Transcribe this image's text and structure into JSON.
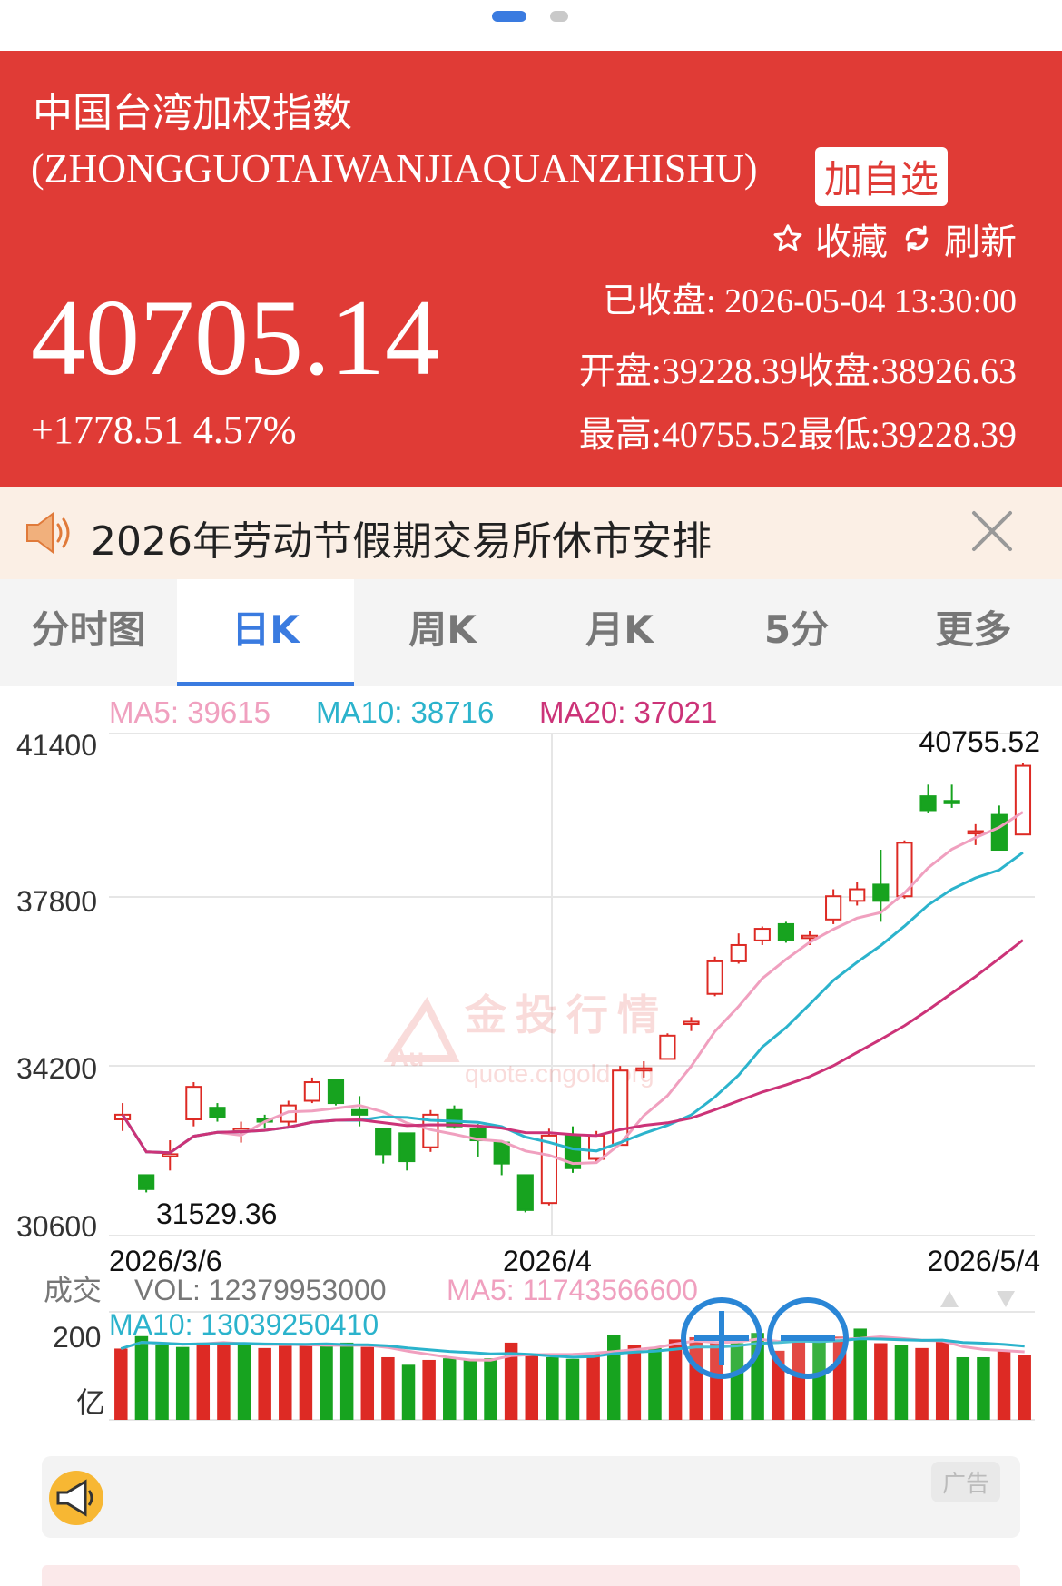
{
  "header": {
    "name": "中国台湾加权指数",
    "pinyin": "(ZHONGGUOTAIWANJIAQUANZHISHU)",
    "add_label": "加自选",
    "favorite_label": "收藏",
    "refresh_label": "刷新",
    "price": "40705.14",
    "change": "+1778.51 4.57%",
    "status": "已收盘: 2026-05-04 13:30:00",
    "open_close": "开盘:39228.39收盘:38926.63",
    "high_low": "最高:40755.52最低:39228.39"
  },
  "notice": {
    "text": "2026年劳动节假期交易所休市安排"
  },
  "tabs": [
    {
      "label": "分时图",
      "active": false
    },
    {
      "label": "日K",
      "active": true
    },
    {
      "label": "周K",
      "active": false
    },
    {
      "label": "月K",
      "active": false
    },
    {
      "label": "5分",
      "active": false
    },
    {
      "label": "更多",
      "active": false
    }
  ],
  "ma_legend": {
    "ma5": "MA5: 39615",
    "ma10": "MA10: 38716",
    "ma20": "MA20: 37021"
  },
  "watermark": {
    "cn": "金投行情",
    "url": "quote.cngold.org"
  },
  "colors": {
    "up": "#dd2a24",
    "down": "#17a31f",
    "ma5": "#f0a0bf",
    "ma10": "#2bb3cc",
    "ma20": "#cc3378",
    "header": "#e03b36",
    "accent": "#3a7be0"
  },
  "volume_legend": {
    "label": "成交",
    "vol": "VOL: 12379953000",
    "ma5": "MA5: 11743566600",
    "ma10": "MA10: 13039250410",
    "axis_top": "200",
    "axis_unit": "亿"
  },
  "ad": {
    "label": "广告"
  },
  "chart_data": {
    "type": "candlestick",
    "title": "",
    "ylim": [
      30600,
      41400
    ],
    "y_ticks": [
      "41400",
      "37800",
      "34200",
      "30600"
    ],
    "x_ticks": [
      "2026/3/6",
      "2026/4",
      "2026/5/4"
    ],
    "max_label": "40755.52",
    "min_label": "31529.36",
    "candles": [
      {
        "o": 33100,
        "c": 33200,
        "h": 33450,
        "l": 32850
      },
      {
        "o": 31900,
        "c": 31600,
        "h": 31900,
        "l": 31529.36
      },
      {
        "o": 32300,
        "c": 32350,
        "h": 32650,
        "l": 32000
      },
      {
        "o": 33100,
        "c": 33800,
        "h": 33900,
        "l": 32950
      },
      {
        "o": 33350,
        "c": 33150,
        "h": 33450,
        "l": 33050
      },
      {
        "o": 32850,
        "c": 32900,
        "h": 33050,
        "l": 32600
      },
      {
        "o": 33100,
        "c": 33050,
        "h": 33200,
        "l": 32900
      },
      {
        "o": 33050,
        "c": 33400,
        "h": 33500,
        "l": 32950
      },
      {
        "o": 33500,
        "c": 33900,
        "h": 34000,
        "l": 33450
      },
      {
        "o": 33950,
        "c": 33450,
        "h": 33950,
        "l": 33400
      },
      {
        "o": 33300,
        "c": 33200,
        "h": 33600,
        "l": 32950
      },
      {
        "o": 32900,
        "c": 32350,
        "h": 32900,
        "l": 32150
      },
      {
        "o": 32800,
        "c": 32200,
        "h": 32800,
        "l": 32000
      },
      {
        "o": 32500,
        "c": 33200,
        "h": 33300,
        "l": 32400
      },
      {
        "o": 33300,
        "c": 32950,
        "h": 33400,
        "l": 32900
      },
      {
        "o": 32900,
        "c": 32650,
        "h": 33000,
        "l": 32300
      },
      {
        "o": 32600,
        "c": 32150,
        "h": 32600,
        "l": 31900
      },
      {
        "o": 31900,
        "c": 31150,
        "h": 31900,
        "l": 31100
      },
      {
        "o": 31300,
        "c": 32750,
        "h": 32900,
        "l": 31250
      },
      {
        "o": 32750,
        "c": 32050,
        "h": 32950,
        "l": 31950
      },
      {
        "o": 32250,
        "c": 32750,
        "h": 32850,
        "l": 32150
      },
      {
        "o": 32550,
        "c": 34150,
        "h": 34250,
        "l": 32550
      },
      {
        "o": 34150,
        "c": 34200,
        "h": 34350,
        "l": 34000
      },
      {
        "o": 34400,
        "c": 34900,
        "h": 34950,
        "l": 34400
      },
      {
        "o": 35150,
        "c": 35200,
        "h": 35300,
        "l": 35000
      },
      {
        "o": 35800,
        "c": 36500,
        "h": 36600,
        "l": 35750
      },
      {
        "o": 36500,
        "c": 36850,
        "h": 37100,
        "l": 36450
      },
      {
        "o": 36950,
        "c": 37200,
        "h": 37250,
        "l": 36850
      },
      {
        "o": 37300,
        "c": 36950,
        "h": 37350,
        "l": 36900
      },
      {
        "o": 37000,
        "c": 37050,
        "h": 37150,
        "l": 36850
      },
      {
        "o": 37400,
        "c": 37900,
        "h": 38050,
        "l": 37300
      },
      {
        "o": 37800,
        "c": 38050,
        "h": 38200,
        "l": 37700
      },
      {
        "o": 38150,
        "c": 37800,
        "h": 38900,
        "l": 37350
      },
      {
        "o": 37900,
        "c": 39050,
        "h": 39100,
        "l": 37850
      },
      {
        "o": 40050,
        "c": 39750,
        "h": 40300,
        "l": 39700
      },
      {
        "o": 39950,
        "c": 39900,
        "h": 40300,
        "l": 39800
      },
      {
        "o": 39250,
        "c": 39300,
        "h": 39450,
        "l": 39000
      },
      {
        "o": 39650,
        "c": 38900,
        "h": 39850,
        "l": 38900
      },
      {
        "o": 39228.39,
        "c": 40705.14,
        "h": 40755.52,
        "l": 39228.39
      }
    ],
    "volume": {
      "ylim": [
        0,
        200
      ],
      "values": [
        132,
        155,
        139,
        135,
        143,
        144,
        143,
        133,
        137,
        138,
        139,
        143,
        135,
        116,
        102,
        111,
        114,
        112,
        114,
        143,
        121,
        116,
        113,
        125,
        158,
        138,
        133,
        149,
        153,
        143,
        142,
        161,
        128,
        154,
        150,
        154,
        169,
        142,
        139,
        133,
        148,
        116,
        116,
        129,
        121
      ]
    }
  }
}
